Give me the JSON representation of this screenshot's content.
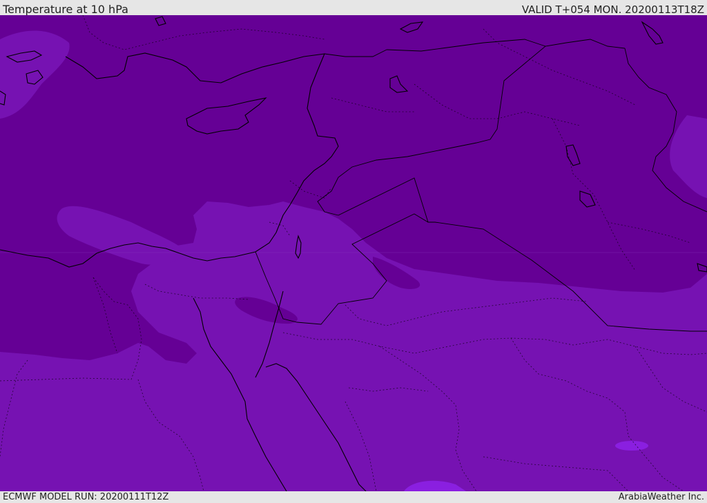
{
  "header": {
    "title": "Temperature at 10 hPa",
    "valid": "VALID T+054 MON. 20200113T18Z"
  },
  "footer": {
    "model_run": "ECMWF MODEL RUN: 20200111T12Z",
    "credit": "ArabiaWeather Inc."
  },
  "map": {
    "region": "Eastern Mediterranean / Middle East",
    "colors": {
      "cold_dark": "#650095",
      "mid_purple": "#7612b2",
      "light_purple": "#7c1bbe",
      "violet_patch": "#8a1fe0",
      "borders": "#000000"
    }
  }
}
